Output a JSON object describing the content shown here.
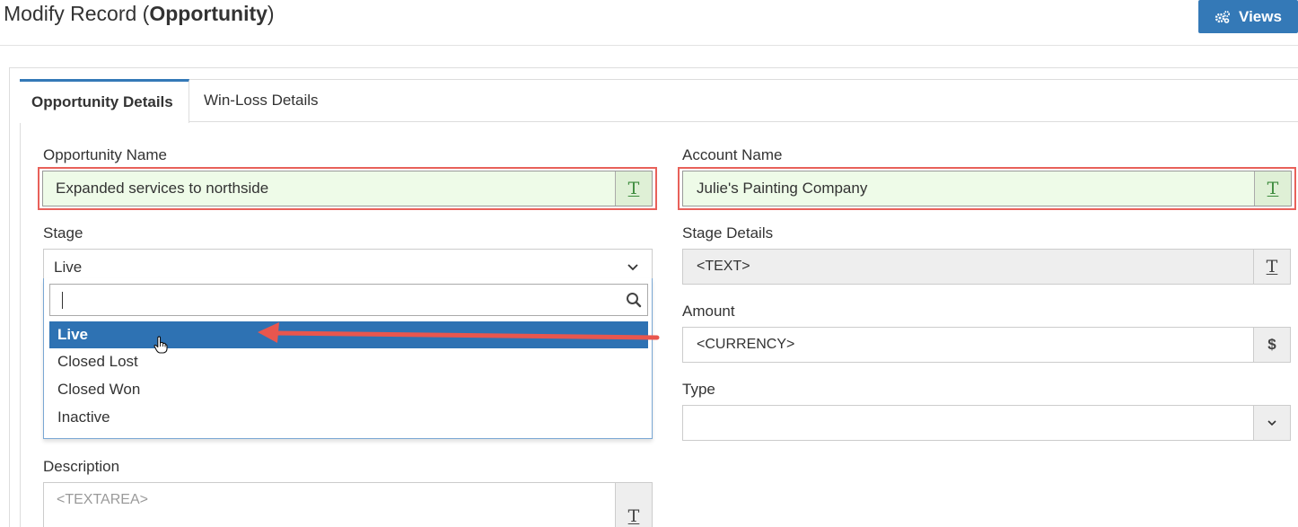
{
  "header": {
    "title_prefix": "Modify Record (",
    "title_entity": "Opportunity",
    "title_suffix": ")",
    "views_label": "Views"
  },
  "tabs": [
    {
      "label": "Opportunity Details",
      "active": true
    },
    {
      "label": "Win-Loss Details",
      "active": false
    }
  ],
  "fields": {
    "opportunity_name": {
      "label": "Opportunity Name",
      "value": "Expanded services to northside"
    },
    "account_name": {
      "label": "Account Name",
      "value": "Julie's Painting Company"
    },
    "stage": {
      "label": "Stage",
      "value": "Live"
    },
    "stage_details": {
      "label": "Stage Details",
      "placeholder": "<TEXT>"
    },
    "amount": {
      "label": "Amount",
      "placeholder": "<CURRENCY>",
      "addon": "$"
    },
    "type": {
      "label": "Type",
      "value": ""
    },
    "description": {
      "label": "Description",
      "placeholder": "<TEXTAREA>"
    }
  },
  "stage_dropdown": {
    "search_value": "",
    "options": [
      "Live",
      "Closed Lost",
      "Closed Won",
      "Inactive"
    ],
    "selected_index": 0
  },
  "icons": {
    "text_addon": "T",
    "views": "gears-icon",
    "search": "search-icon",
    "chevron": "chevron-down-icon"
  },
  "colors": {
    "accent": "#3479b7",
    "highlight_border": "#e8615a",
    "valid_field_bg": "#eefbe8",
    "selected_option_bg": "#2e72b3"
  }
}
